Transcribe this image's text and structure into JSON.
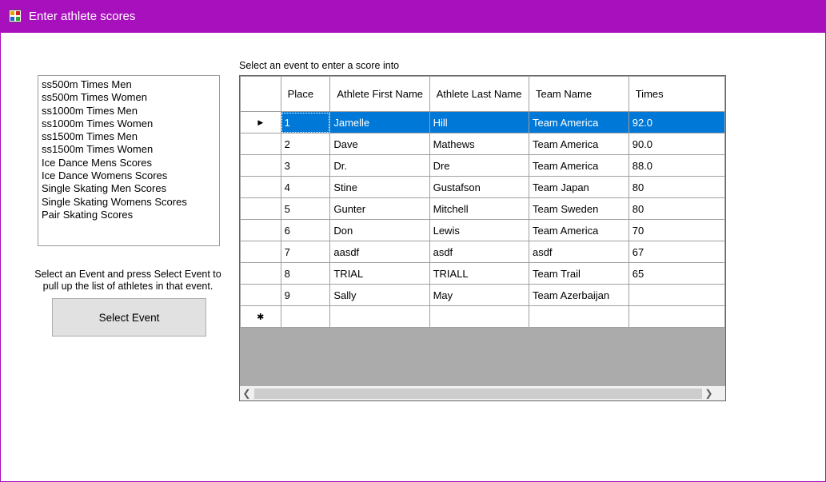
{
  "window": {
    "title": "Enter athlete scores"
  },
  "events": {
    "items": [
      "ss500m Times Men",
      "ss500m Times Women",
      "ss1000m Times Men",
      "ss1000m Times Women",
      "ss1500m Times Men",
      "ss1500m Times Women",
      "Ice Dance Mens Scores",
      "Ice Dance Womens Scores",
      "Single Skating Men Scores",
      "Single Skating Womens Scores",
      "Pair Skating Scores"
    ]
  },
  "instructions": {
    "line1": "Select an Event and press Select Event to",
    "line2": "pull up the list of athletes in that event."
  },
  "select_button": {
    "label": "Select Event"
  },
  "grid": {
    "caption": "Select an event to enter a score into",
    "columns": [
      "Place",
      "Athlete First Name",
      "Athlete Last Name",
      "Team Name",
      "Times"
    ],
    "rows": [
      [
        "1",
        "Jamelle",
        "Hill",
        "Team America",
        "92.0"
      ],
      [
        "2",
        "Dave",
        "Mathews",
        "Team America",
        "90.0"
      ],
      [
        "3",
        "Dr.",
        "Dre",
        "Team America",
        "88.0"
      ],
      [
        "4",
        "Stine",
        "Gustafson",
        "Team Japan",
        "80"
      ],
      [
        "5",
        "Gunter",
        "Mitchell",
        "Team Sweden",
        "80"
      ],
      [
        "6",
        "Don",
        "Lewis",
        "Team America",
        "70"
      ],
      [
        "7",
        "aasdf",
        "asdf",
        "asdf",
        "67"
      ],
      [
        "8",
        "TRIAL",
        "TRIALL",
        "Team Trail",
        "65"
      ],
      [
        "9",
        "Sally",
        "May",
        "Team Azerbaijan",
        ""
      ]
    ],
    "selected_row": 0,
    "current_row_marker": "▶",
    "new_row_marker": "✱"
  },
  "colors": {
    "titlebar": "#a80fbd",
    "selection": "#0078d7"
  }
}
